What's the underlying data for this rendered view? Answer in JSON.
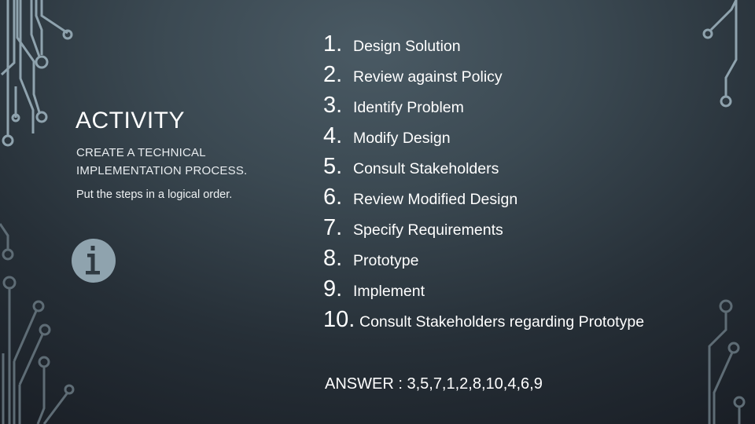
{
  "slide": {
    "title": "ACTIVITY",
    "subtitle_line1": "CREATE A TECHNICAL",
    "subtitle_line2": "IMPLEMENTATION PROCESS.",
    "instruction": "Put the steps in a logical order.",
    "info_icon": "info-circle-icon",
    "steps": [
      {
        "num": "1.",
        "text": "Design Solution"
      },
      {
        "num": "2.",
        "text": "Review against Policy"
      },
      {
        "num": "3.",
        "text": "Identify Problem"
      },
      {
        "num": "4.",
        "text": "Modify Design"
      },
      {
        "num": "5.",
        "text": "Consult Stakeholders"
      },
      {
        "num": "6.",
        "text": "Review Modified Design"
      },
      {
        "num": "7.",
        "text": "Specify Requirements"
      },
      {
        "num": "8.",
        "text": "Prototype"
      },
      {
        "num": "9.",
        "text": "Implement"
      },
      {
        "num": "10.",
        "text": "Consult Stakeholders regarding Prototype"
      }
    ],
    "answer": "ANSWER : 3,5,7,1,2,8,10,4,6,9"
  },
  "colors": {
    "circuit_light": "#8fa3ae",
    "circuit_dark": "#5e6c75",
    "icon_fill": "#8fa3ae",
    "text": "#ffffff"
  }
}
